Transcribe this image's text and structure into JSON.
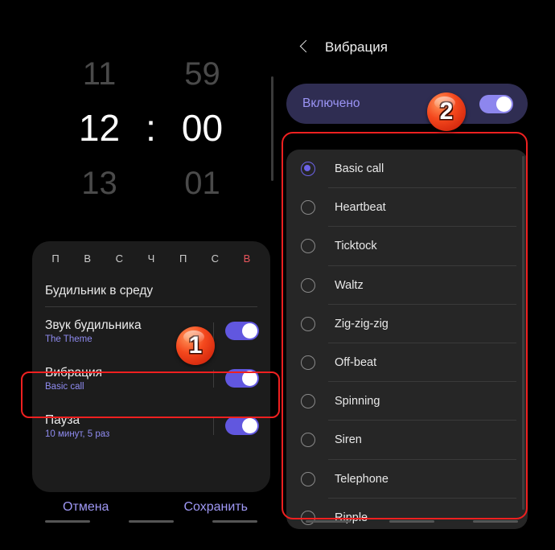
{
  "left_panel": {
    "time_picker": {
      "prev_hour": "11",
      "prev_minute": "59",
      "hour": "12",
      "separator": ":",
      "minute": "00",
      "next_hour": "13",
      "next_minute": "01"
    },
    "weekdays": [
      {
        "label": "П",
        "is_weekend": false
      },
      {
        "label": "В",
        "is_weekend": false
      },
      {
        "label": "С",
        "is_weekend": false
      },
      {
        "label": "Ч",
        "is_weekend": false
      },
      {
        "label": "П",
        "is_weekend": false
      },
      {
        "label": "С",
        "is_weekend": false
      },
      {
        "label": "В",
        "is_weekend": true
      }
    ],
    "alarm_name": "Будильник в среду",
    "options": [
      {
        "title": "Звук будильника",
        "subtitle": "The Theme",
        "toggle_on": true
      },
      {
        "title": "Вибрация",
        "subtitle": "Basic call",
        "toggle_on": true
      },
      {
        "title": "Пауза",
        "subtitle": "10 минут, 5 раз",
        "toggle_on": true
      }
    ],
    "cancel_label": "Отмена",
    "save_label": "Сохранить"
  },
  "right_panel": {
    "title": "Вибрация",
    "back_icon": "chevron-left-icon",
    "enabled": {
      "label": "Включено",
      "toggle_on": true
    },
    "vibration_patterns": [
      {
        "label": "Basic call",
        "selected": true
      },
      {
        "label": "Heartbeat",
        "selected": false
      },
      {
        "label": "Ticktock",
        "selected": false
      },
      {
        "label": "Waltz",
        "selected": false
      },
      {
        "label": "Zig-zig-zig",
        "selected": false
      },
      {
        "label": "Off-beat",
        "selected": false
      },
      {
        "label": "Spinning",
        "selected": false
      },
      {
        "label": "Siren",
        "selected": false
      },
      {
        "label": "Telephone",
        "selected": false
      },
      {
        "label": "Ripple",
        "selected": false
      }
    ]
  },
  "annotations": {
    "badge_one": "1",
    "badge_two": "2",
    "highlight_color": "#ef2020",
    "badge_color": "#f4481d"
  },
  "colors": {
    "accent_purple": "#6157df",
    "subtitle_purple": "#8f8bf0",
    "weekend_red": "#e8555c",
    "card_bg": "#1c1c1c",
    "list_bg": "#262626",
    "banner_bg": "#2f2d52"
  }
}
